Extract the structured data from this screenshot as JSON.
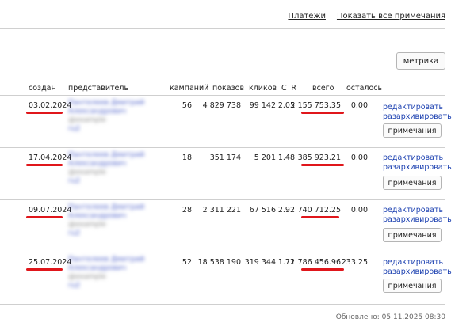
{
  "links": {
    "payments": "Платежи",
    "show_notes": "Показать все примечания"
  },
  "metrika_label": "метрика",
  "columns": {
    "created": "создан",
    "rep": "представитель",
    "campaigns": "кампаний",
    "impressions": "показов",
    "clicks": "кликов",
    "ctr": "CTR",
    "total": "всего",
    "remaining": "осталось"
  },
  "row_actions": {
    "edit": "редактировать",
    "unarchive": "разархивировать",
    "notes": "примечания"
  },
  "rows": [
    {
      "created": "03.02.2024",
      "rep_name": "Пантелеев Дмитрий",
      "rep_sub": "Александрович",
      "rep_extra": "@example",
      "rep_tail": "ru2",
      "campaigns": "56",
      "impressions": "4 829 738",
      "clicks": "99 142",
      "ctr": "2.05",
      "total": "2 155 753.35",
      "remaining": "0.00"
    },
    {
      "created": "17.04.2024",
      "rep_name": "Пантелеев Дмитрий",
      "rep_sub": "Александрович",
      "rep_extra": "@example",
      "rep_tail": "ru2",
      "campaigns": "18",
      "impressions": "351 174",
      "clicks": "5 201",
      "ctr": "1.48",
      "total": "385 923.21",
      "remaining": "0.00"
    },
    {
      "created": "09.07.2024",
      "rep_name": "Пантелеев Дмитрий",
      "rep_sub": "Александрович",
      "rep_extra": "@example",
      "rep_tail": "ru2",
      "campaigns": "28",
      "impressions": "2 311 221",
      "clicks": "67 516",
      "ctr": "2.92",
      "total": "740 712.25",
      "remaining": "0.00"
    },
    {
      "created": "25.07.2024",
      "rep_name": "Пантелеев Дмитрий",
      "rep_sub": "Александрович",
      "rep_extra": "@example",
      "rep_tail": "ru2",
      "campaigns": "52",
      "impressions": "18 538 190",
      "clicks": "319 344",
      "ctr": "1.72",
      "total": "1 786 456.96",
      "remaining": "233.25"
    }
  ],
  "updated": "Обновлено: 05.11.2025 08:30",
  "colors": {
    "link": "#1a3fb0",
    "underline": "#e0161b",
    "blurred_name": "#4b5fc9"
  }
}
